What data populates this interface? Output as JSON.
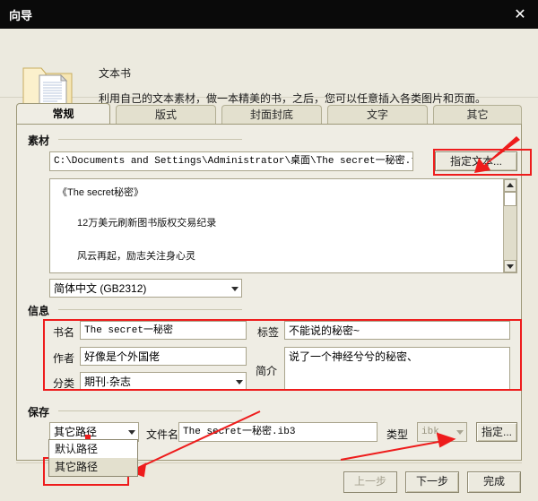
{
  "window": {
    "title": "向导",
    "close_label": "✕"
  },
  "header": {
    "icon": "folder-document-icon",
    "title": "文本书",
    "description": "利用自己的文本素材，做一本精美的书，之后，您可以任意插入各类图片和页面。"
  },
  "tabs": [
    {
      "label": "常规",
      "active": true
    },
    {
      "label": "版式",
      "active": false
    },
    {
      "label": "封面封底",
      "active": false
    },
    {
      "label": "文字",
      "active": false
    },
    {
      "label": "其它",
      "active": false
    }
  ],
  "sections": {
    "material": {
      "label": "素材",
      "path_value": "C:\\Documents and Settings\\Administrator\\桌面\\The secret一秘密.txt",
      "browse_button": "指定文本...",
      "preview_lines": [
        "《The secret秘密》",
        "12万美元刷新图书版权交易纪录",
        "风云再起，励志关注身心灵"
      ],
      "encoding_value": "简体中文 (GB2312)"
    },
    "info": {
      "label": "信息",
      "book_name_label": "书名",
      "book_name_value": "The secret一秘密",
      "tag_label": "标签",
      "tag_value": "不能说的秘密~",
      "author_label": "作者",
      "author_value": "好像是个外国佬",
      "category_label": "分类",
      "category_value": "期刊·杂志",
      "summary_label": "简介",
      "summary_value": "说了一个神经兮兮的秘密、"
    },
    "save": {
      "label": "保存",
      "path_mode_value": "其它路径",
      "path_mode_options": [
        {
          "label": "默认路径",
          "selected": false
        },
        {
          "label": "其它路径",
          "selected": true
        }
      ],
      "filename_label": "文件名",
      "filename_value": "The secret一秘密.ib3",
      "type_label": "类型",
      "type_value": "ibk",
      "specify_button": "指定..."
    }
  },
  "footer": {
    "prev_label": "上一步",
    "next_label": "下一步",
    "finish_label": "完成",
    "prev_disabled": true
  },
  "colors": {
    "titlebar_bg": "#0a0a0a",
    "panel_bg": "#efede4",
    "window_bg": "#ece9dd",
    "annotation_red": "#ee1c1c",
    "border": "#9d9878"
  }
}
